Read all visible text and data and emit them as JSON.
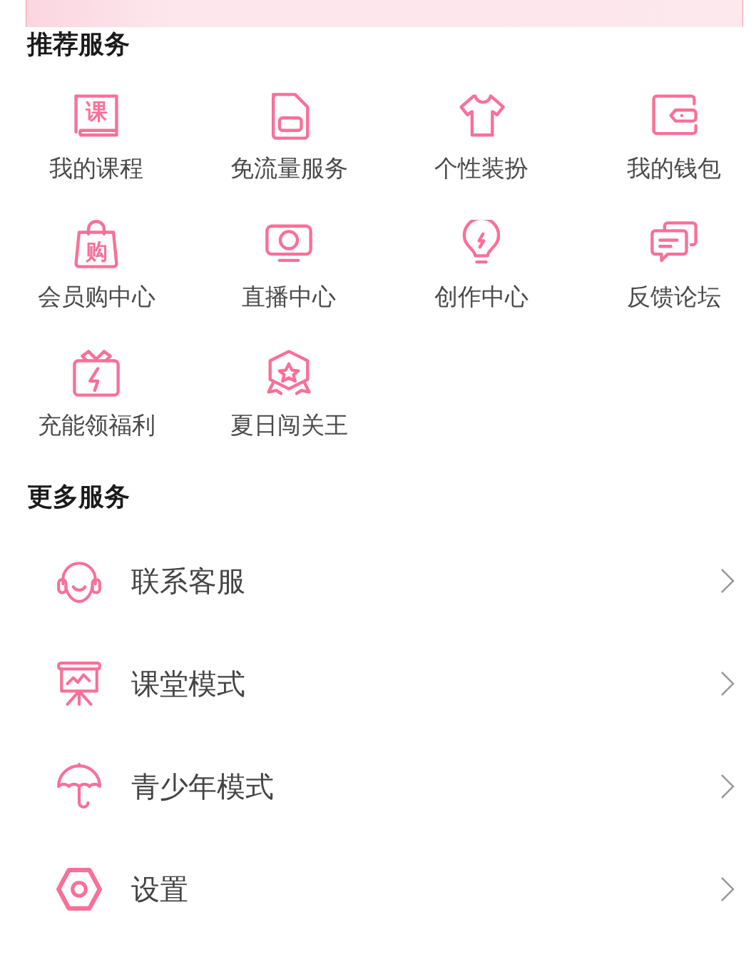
{
  "banner": {
    "kind": "promo"
  },
  "recommended": {
    "title": "推荐服务",
    "items": [
      {
        "label": "我的课程",
        "kind": "book",
        "glyph": "课"
      },
      {
        "label": "免流量服务",
        "kind": "sim"
      },
      {
        "label": "个性装扮",
        "kind": "shirt"
      },
      {
        "label": "我的钱包",
        "kind": "wallet"
      },
      {
        "label": "会员购中心",
        "kind": "bag",
        "glyph": "购"
      },
      {
        "label": "直播中心",
        "kind": "tv"
      },
      {
        "label": "创作中心",
        "kind": "bulb"
      },
      {
        "label": "反馈论坛",
        "kind": "chat"
      },
      {
        "label": "充能领福利",
        "kind": "gift"
      },
      {
        "label": "夏日闯关王",
        "kind": "medal"
      }
    ]
  },
  "more": {
    "title": "更多服务",
    "items": [
      {
        "label": "联系客服",
        "kind": "headset"
      },
      {
        "label": "课堂模式",
        "kind": "board"
      },
      {
        "label": "青少年模式",
        "kind": "umbrella"
      },
      {
        "label": "设置",
        "kind": "hex"
      }
    ]
  }
}
